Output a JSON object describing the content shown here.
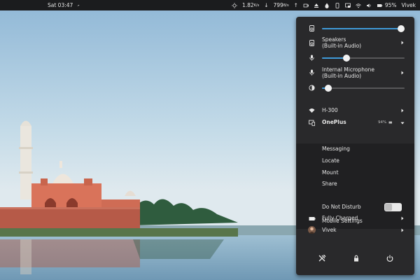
{
  "topbar": {
    "clock": "Sat 03:47",
    "net_up": "1.82",
    "net_up_unit": "K/s",
    "net_down": "799",
    "net_down_unit": "B/s",
    "battery": "95%",
    "user": "Vivek"
  },
  "menu": {
    "speaker_level": 0.96,
    "speakers_title": "Speakers",
    "speakers_sub": "(Built-in Audio)",
    "mic_level": 0.3,
    "mic_title": "Internal Microphone",
    "mic_sub": "(Built-in Audio)",
    "brightness_level": 0.08,
    "wifi": "H-300",
    "device": "OnePlus",
    "device_battery": "94%",
    "device_items": [
      "Messaging",
      "Locate",
      "Mount",
      "Share"
    ],
    "dnd": "Do Not Disturb",
    "mobile_settings": "Mobile Settings",
    "battery_status": "Fully Charged",
    "user": "Vivek"
  },
  "colors": {
    "accent": "#3f9ad8",
    "menu_bg": "#29292b",
    "submenu_bg": "#202022",
    "topbar_bg": "#1b1c1e"
  },
  "icons": {
    "speaker": "speaker-icon",
    "mic": "microphone-icon",
    "brightness": "brightness-icon",
    "wifi": "wifi-icon",
    "phone": "phone-icon",
    "battery": "battery-icon",
    "settings": "settings-icon",
    "lock": "lock-icon",
    "power": "power-icon"
  }
}
